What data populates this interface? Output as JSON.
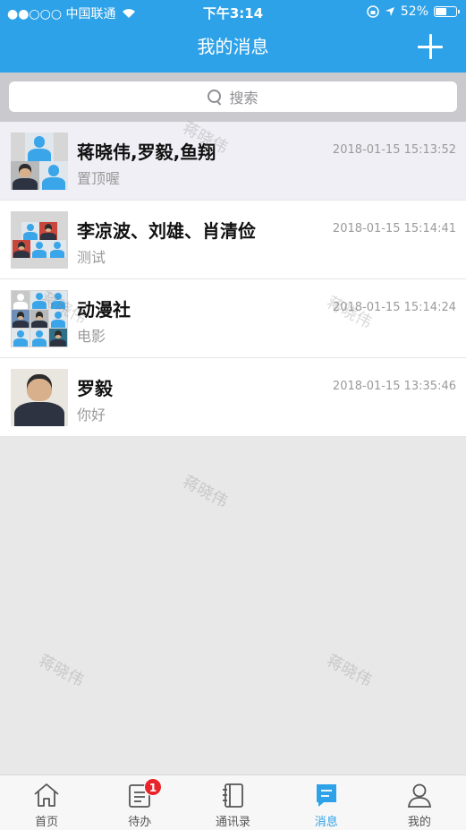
{
  "status_bar": {
    "carrier": "●●○○○ 中国联通",
    "time": "下午3:14",
    "battery": "52%",
    "battery_level": 0.52
  },
  "nav": {
    "title": "我的消息",
    "add_icon": "plus-icon"
  },
  "search": {
    "placeholder": "搜索",
    "icon": "search-icon"
  },
  "conversations": [
    {
      "name": "蒋晓伟,罗毅,鱼翔",
      "preview": "置顶喔",
      "time": "2018-01-15 15:13:52",
      "pinned": true
    },
    {
      "name": "李凉波、刘雄、肖清俭",
      "preview": "测试",
      "time": "2018-01-15 15:14:41",
      "pinned": false
    },
    {
      "name": "动漫社",
      "preview": "电影",
      "time": "2018-01-15 15:14:24",
      "pinned": false
    },
    {
      "name": "罗毅",
      "preview": "你好",
      "time": "2018-01-15 13:35:46",
      "pinned": false
    }
  ],
  "watermark": "蒋晓伟",
  "tabbar": {
    "tabs": [
      {
        "label": "首页",
        "icon": "home-icon",
        "active": false
      },
      {
        "label": "待办",
        "icon": "todo-icon",
        "active": false,
        "badge": "1"
      },
      {
        "label": "通讯录",
        "icon": "contacts-icon",
        "active": false
      },
      {
        "label": "消息",
        "icon": "message-icon",
        "active": true
      },
      {
        "label": "我的",
        "icon": "profile-icon",
        "active": false
      }
    ]
  },
  "colors": {
    "primary": "#2ea2e8",
    "badge": "#e8252b",
    "pinned_row": "#f0eff5",
    "empty_area": "#e8e8e8"
  }
}
